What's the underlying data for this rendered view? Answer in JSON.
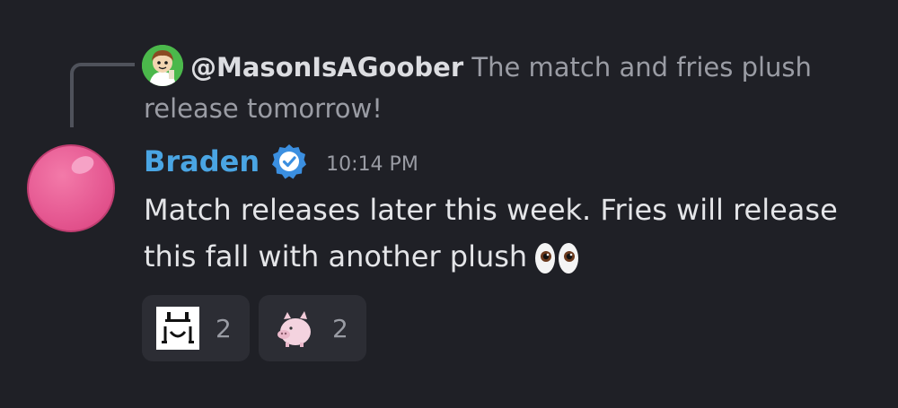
{
  "reply": {
    "username": "@MasonIsAGoober",
    "text": " The match and fries plush release tomorrow!",
    "avatar_icon": "cartoon-avatar-icon"
  },
  "message": {
    "author": "Braden",
    "verified_icon": "verified-badge-icon",
    "timestamp": "10:14 PM",
    "text": "Match releases later this week. Fries will release this fall with another plush",
    "emoji_icon": "eyes-emoji-icon",
    "author_color": "#4aa5e3",
    "avatar_color": "#e65a93"
  },
  "reactions": [
    {
      "icon": "custom-emote-face-icon",
      "count": "2"
    },
    {
      "icon": "custom-emote-pig-icon",
      "count": "2"
    }
  ]
}
